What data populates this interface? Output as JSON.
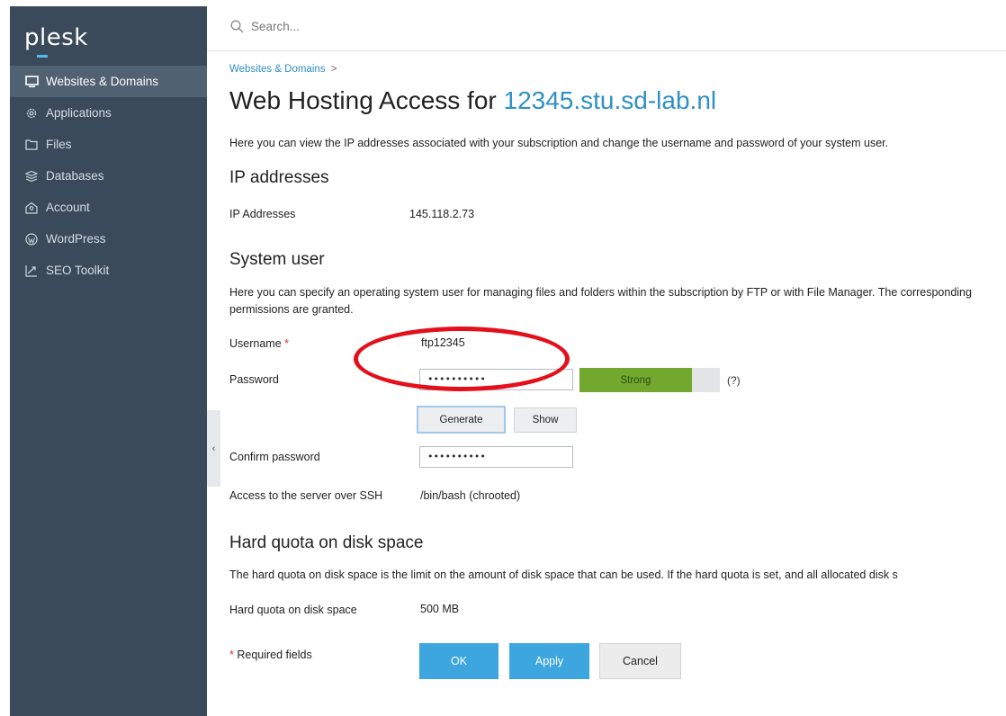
{
  "app": {
    "logo": "plesk"
  },
  "sidebar": {
    "items": [
      {
        "label": "Websites & Domains",
        "icon": "monitor-icon"
      },
      {
        "label": "Applications",
        "icon": "gear-icon"
      },
      {
        "label": "Files",
        "icon": "folder-icon"
      },
      {
        "label": "Databases",
        "icon": "database-icon"
      },
      {
        "label": "Account",
        "icon": "account-icon"
      },
      {
        "label": "WordPress",
        "icon": "wordpress-icon"
      },
      {
        "label": "SEO Toolkit",
        "icon": "chart-icon"
      }
    ],
    "active_index": 0,
    "collapse_glyph": "‹"
  },
  "search": {
    "placeholder": "Search..."
  },
  "breadcrumb": {
    "label": "Websites & Domains",
    "separator": ">"
  },
  "page": {
    "title_prefix": "Web Hosting Access for ",
    "title_domain": "12345.stu.sd-lab.nl",
    "intro": "Here you can view the IP addresses associated with your subscription and change the username and password of your system user."
  },
  "ip_section": {
    "title": "IP addresses",
    "label": "IP Addresses",
    "value": "145.118.2.73"
  },
  "system_user": {
    "title": "System user",
    "description": "Here you can specify an operating system user for managing files and folders within the subscription by FTP or with File Manager. The corresponding permissions are granted.",
    "username_label": "Username",
    "required_mark": "*",
    "username_value": "ftp12345",
    "password_label": "Password",
    "password_value": "••••••••••",
    "strength_label": "Strong",
    "strength_fraction": 0.8,
    "help_label": "(?)",
    "generate_label": "Generate",
    "show_label": "Show",
    "confirm_label": "Confirm password",
    "confirm_value": "••••••••••",
    "ssh_label": "Access to the server over SSH",
    "ssh_value": "/bin/bash (chrooted)"
  },
  "quota": {
    "title": "Hard quota on disk space",
    "description": "The hard quota on disk space is the limit on the amount of disk space that can be used. If the hard quota is set, and all allocated disk s",
    "label": "Hard quota on disk space",
    "value": "500 MB"
  },
  "footer": {
    "required_note": "Required fields",
    "ok_label": "OK",
    "apply_label": "Apply",
    "cancel_label": "Cancel"
  },
  "colors": {
    "accent": "#2f8fc7",
    "sidebar": "#3a4a5a",
    "strength": "#72a82e",
    "annotation": "#e3101b"
  }
}
